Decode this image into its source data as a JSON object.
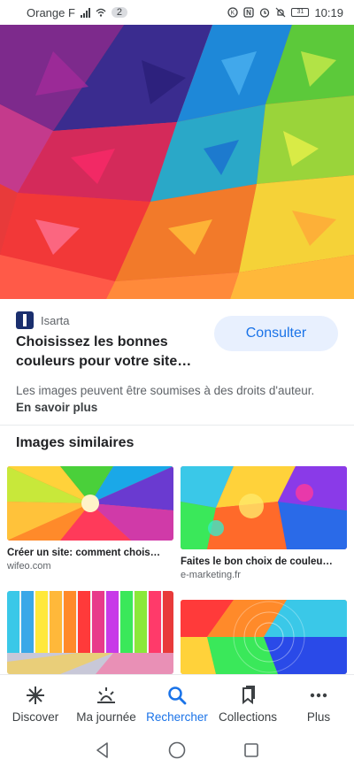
{
  "status_bar": {
    "carrier": "Orange F",
    "notification_count": "2",
    "battery": "31",
    "time": "10:19"
  },
  "result": {
    "source_name": "Isarta",
    "title": "Choisissez les bonnes couleurs pour votre site…",
    "consult_label": "Consulter",
    "copyright_text": "Les images peuvent être soumises à des droits d'auteur.",
    "learn_more": "En savoir plus"
  },
  "similar": {
    "heading": "Images similaires",
    "items": [
      {
        "caption": "Créer un site: comment chois…",
        "domain": "wifeo.com"
      },
      {
        "caption": "Faites le bon choix de couleu…",
        "domain": "e-marketing.fr"
      },
      {
        "caption": "",
        "domain": ""
      },
      {
        "caption": "",
        "domain": ""
      }
    ]
  },
  "bottom_nav": [
    {
      "label": "Discover",
      "icon": "asterisk-icon"
    },
    {
      "label": "Ma journée",
      "icon": "sunrise-icon"
    },
    {
      "label": "Rechercher",
      "icon": "search-icon",
      "active": true
    },
    {
      "label": "Collections",
      "icon": "bookmarks-icon"
    },
    {
      "label": "Plus",
      "icon": "more-dots-icon"
    }
  ],
  "colors": {
    "accent": "#1a73e8",
    "button_bg": "#e8f0fe"
  }
}
